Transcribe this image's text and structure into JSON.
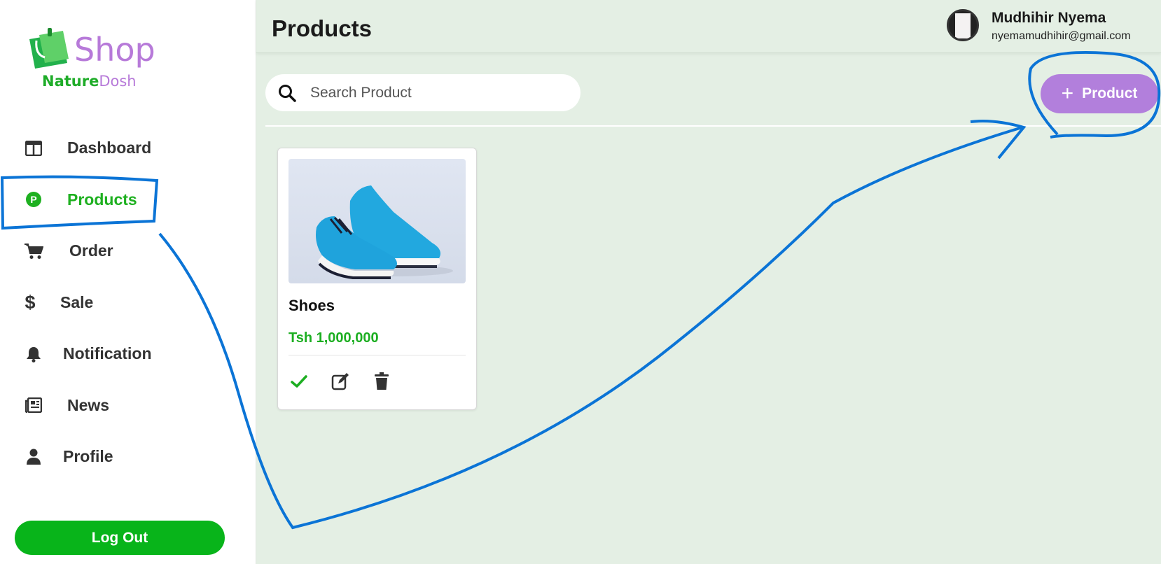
{
  "brand": {
    "name": "Shop",
    "sub_part1": "Nature",
    "sub_part2": "Dosh",
    "color_green": "#1eac28",
    "color_purple": "#b77ad9"
  },
  "sidebar": {
    "items": [
      {
        "label": "Dashboard",
        "icon": "dashboard-icon"
      },
      {
        "label": "Products",
        "icon": "products-p-icon",
        "active": true
      },
      {
        "label": "Order",
        "icon": "cart-icon"
      },
      {
        "label": "Sale",
        "icon": "dollar-icon"
      },
      {
        "label": "Notification",
        "icon": "bell-icon"
      },
      {
        "label": "News",
        "icon": "newspaper-icon"
      },
      {
        "label": "Profile",
        "icon": "user-icon"
      }
    ],
    "logout_label": "Log Out"
  },
  "header": {
    "title": "Products",
    "user_name": "Mudhihir Nyema",
    "user_email": "nyemamudhihir@gmail.com"
  },
  "toolbar": {
    "search_placeholder": "Search Product",
    "add_label": "Product",
    "add_icon": "plus-icon"
  },
  "products": [
    {
      "name": "Shoes",
      "price": "Tsh 1,000,000"
    }
  ],
  "colors": {
    "accent_green": "#08b41a",
    "accent_purple": "#b27fdc",
    "annotation_blue": "#0b74d6",
    "background": "#e4efe4"
  }
}
